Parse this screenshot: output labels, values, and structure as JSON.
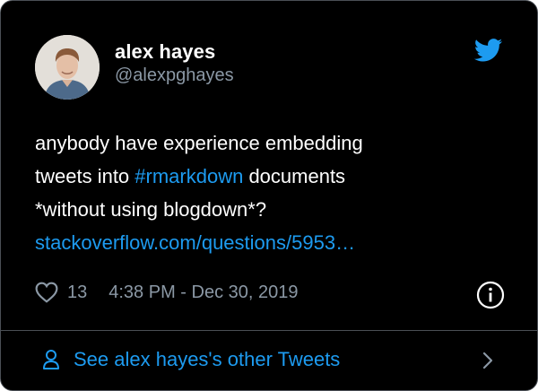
{
  "author": {
    "name": "alex hayes",
    "handle": "@alexpghayes"
  },
  "tweet": {
    "line1": "anybody have experience embedding",
    "line2_prefix": "tweets into ",
    "hashtag": "#rmarkdown",
    "line2_suffix": " documents",
    "line3": "*without using blogdown*?",
    "link": "stackoverflow.com/questions/5953…"
  },
  "meta": {
    "likes": "13",
    "timestamp": "4:38 PM - Dec 30, 2019"
  },
  "footer": {
    "label": "See alex hayes's other Tweets"
  },
  "icons": {
    "brand": "twitter-bird-icon",
    "like": "heart-icon",
    "info": "info-icon",
    "profile": "person-icon",
    "more": "chevron-right-icon"
  },
  "colors": {
    "background": "#000000",
    "accent": "#1d9bf0",
    "muted": "#8b98a5",
    "border": "#4a4f55"
  }
}
